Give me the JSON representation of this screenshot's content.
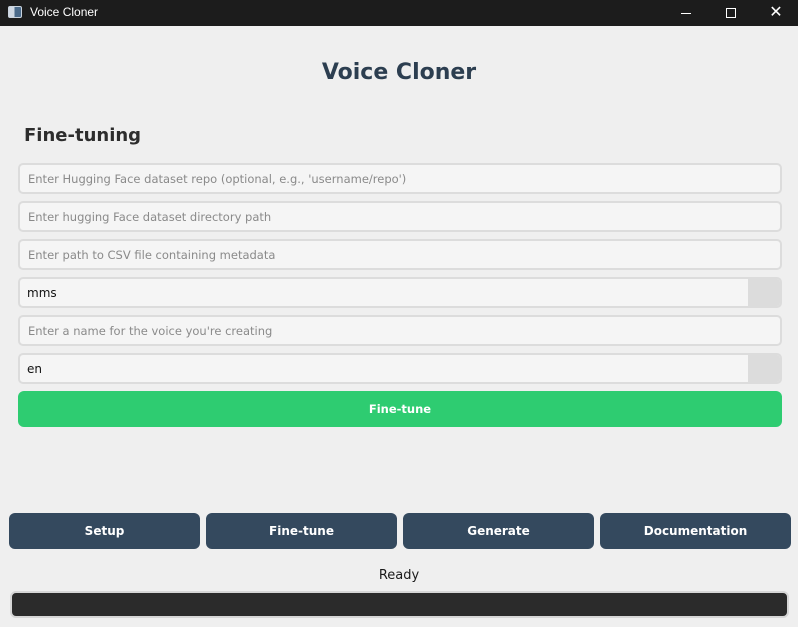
{
  "window": {
    "title": "Voice Cloner",
    "icon": "app-window-icon",
    "controls": {
      "minimize": "minimize-icon",
      "maximize": "maximize-icon",
      "close": "✕"
    }
  },
  "app": {
    "title": "Voice Cloner"
  },
  "finetune": {
    "section_title": "Fine-tuning",
    "dataset_repo_placeholder": "Enter Hugging Face dataset repo (optional, e.g., 'username/repo')",
    "dataset_dir_placeholder": "Enter hugging Face dataset directory path",
    "csv_path_placeholder": "Enter path to CSV file containing metadata",
    "model_select_value": "mms",
    "voice_name_placeholder": "Enter a name for the voice you're creating",
    "language_select_value": "en",
    "finetune_button_label": "Fine-tune"
  },
  "nav": {
    "setup": "Setup",
    "finetune": "Fine-tune",
    "generate": "Generate",
    "documentation": "Documentation"
  },
  "status": {
    "text": "Ready",
    "progress": 0
  },
  "colors": {
    "accent_green": "#2ecc71",
    "nav_button": "#34495e",
    "title_text": "#2c3e50",
    "progress_track": "#2b2b2b"
  }
}
